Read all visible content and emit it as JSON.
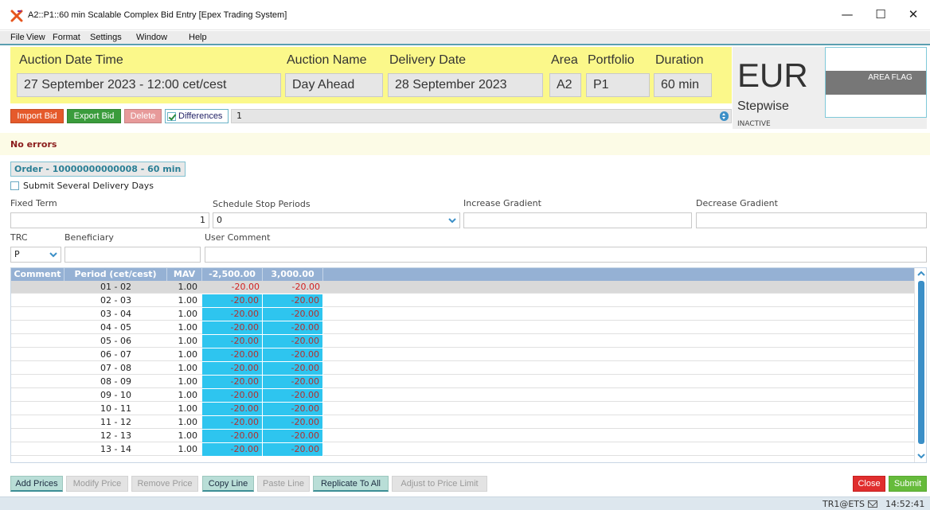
{
  "window": {
    "title": "A2::P1::60 min Scalable Complex Bid Entry [Epex Trading System]",
    "minimize": "—",
    "maximize": "☐",
    "close": "✕"
  },
  "menu": [
    "File",
    "View",
    "Format",
    "Settings",
    "Window",
    "Help"
  ],
  "header": {
    "auction_date_time_label": "Auction Date Time",
    "auction_date_time": "27 September 2023 - 12:00 cet/cest",
    "auction_name_label": "Auction Name",
    "auction_name": "Day Ahead",
    "delivery_date_label": "Delivery Date",
    "delivery_date": "28 September 2023",
    "area_label": "Area",
    "area": "A2",
    "portfolio_label": "Portfolio",
    "portfolio": "P1",
    "duration_label": "Duration",
    "duration": "60 min"
  },
  "currency_panel": {
    "currency": "EUR",
    "type": "Stepwise",
    "status": "INACTIVE",
    "flag_label": "AREA FLAG"
  },
  "toolbar": {
    "import_bid": "Import Bid",
    "export_bid": "Export Bid",
    "delete": "Delete",
    "differences": "Differences",
    "differences_checked": true,
    "differences_value": "1"
  },
  "errors": "No errors",
  "order_tab": "Order - 10000000000008 - 60 min",
  "submit_several_days": "Submit Several Delivery Days",
  "form": {
    "fixed_term_label": "Fixed Term",
    "fixed_term_value": "1",
    "schedule_stop_label": "Schedule Stop Periods",
    "schedule_stop_value": "0",
    "increase_gradient_label": "Increase Gradient",
    "increase_gradient_value": "",
    "decrease_gradient_label": "Decrease Gradient",
    "decrease_gradient_value": "",
    "trc_label": "TRC",
    "trc_value": "P",
    "beneficiary_label": "Beneficiary",
    "beneficiary_value": "",
    "user_comment_label": "User Comment",
    "user_comment_value": ""
  },
  "grid": {
    "headers": [
      "Comment",
      "Period (cet/cest)",
      "MAV",
      "-2,500.00",
      "3,000.00"
    ],
    "rows": [
      {
        "period": "01 - 02",
        "mav": "1.00",
        "p1": "-20.00",
        "p2": "-20.00"
      },
      {
        "period": "02 - 03",
        "mav": "1.00",
        "p1": "-20.00",
        "p2": "-20.00"
      },
      {
        "period": "03 - 04",
        "mav": "1.00",
        "p1": "-20.00",
        "p2": "-20.00"
      },
      {
        "period": "04 - 05",
        "mav": "1.00",
        "p1": "-20.00",
        "p2": "-20.00"
      },
      {
        "period": "05 - 06",
        "mav": "1.00",
        "p1": "-20.00",
        "p2": "-20.00"
      },
      {
        "period": "06 - 07",
        "mav": "1.00",
        "p1": "-20.00",
        "p2": "-20.00"
      },
      {
        "period": "07 - 08",
        "mav": "1.00",
        "p1": "-20.00",
        "p2": "-20.00"
      },
      {
        "period": "08 - 09",
        "mav": "1.00",
        "p1": "-20.00",
        "p2": "-20.00"
      },
      {
        "period": "09 - 10",
        "mav": "1.00",
        "p1": "-20.00",
        "p2": "-20.00"
      },
      {
        "period": "10 - 11",
        "mav": "1.00",
        "p1": "-20.00",
        "p2": "-20.00"
      },
      {
        "period": "11 - 12",
        "mav": "1.00",
        "p1": "-20.00",
        "p2": "-20.00"
      },
      {
        "period": "12 - 13",
        "mav": "1.00",
        "p1": "-20.00",
        "p2": "-20.00"
      },
      {
        "period": "13 - 14",
        "mav": "1.00",
        "p1": "-20.00",
        "p2": "-20.00"
      }
    ]
  },
  "bottom_buttons": {
    "add_prices": "Add Prices",
    "modify_price": "Modify Price",
    "remove_price": "Remove Price",
    "copy_line": "Copy Line",
    "paste_line": "Paste Line",
    "replicate_to_all": "Replicate To All",
    "adjust_to_price_limit": "Adjust to Price Limit",
    "close": "Close",
    "submit": "Submit"
  },
  "status": {
    "user": "TR1@ETS",
    "time": "14:52:41"
  },
  "colors": {
    "header_yellow": "#fbf88a",
    "price_cell_blue": "#2ec5ef",
    "grid_header": "#95b1d4",
    "import_orange": "#e55a2b",
    "export_green": "#3a9c3c",
    "close_red": "#e02e2e",
    "submit_green": "#66bb3b"
  }
}
